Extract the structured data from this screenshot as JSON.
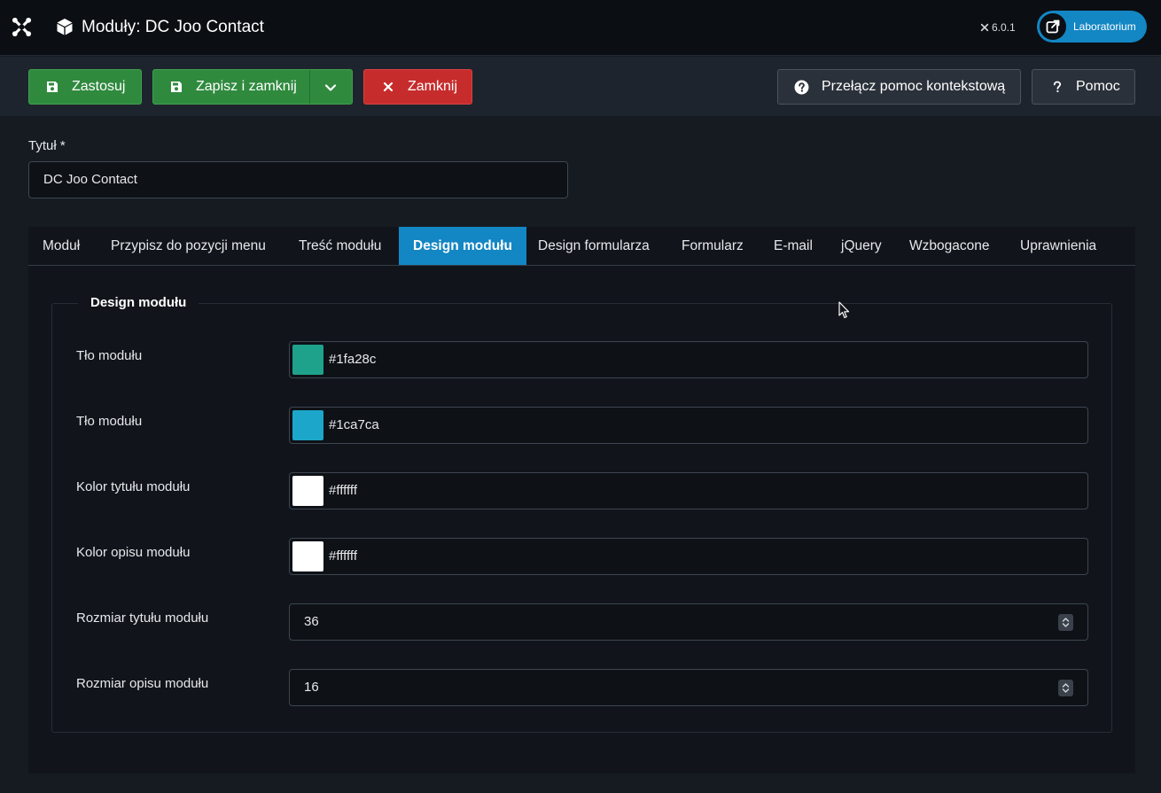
{
  "header": {
    "title": "Moduły: DC Joo Contact",
    "version": "6.0.1",
    "site_button_label": "Laboratorium",
    "logo_icon": "joomla-logo-icon",
    "title_icon": "cube-icon",
    "site_icon": "external-link-icon"
  },
  "toolbar": {
    "apply_label": "Zastosuj",
    "save_close_label": "Zapisz i zamknij",
    "close_label": "Zamknij",
    "context_help_label": "Przełącz pomoc kontekstową",
    "help_label": "Pomoc"
  },
  "form": {
    "title_label": "Tytuł *",
    "title_value": "DC Joo Contact"
  },
  "tabs": [
    "Moduł",
    "Przypisz do pozycji menu",
    "Treść modułu",
    "Design modułu",
    "Design formularza",
    "Formularz",
    "E-mail",
    "jQuery",
    "Wzbogacone",
    "Uprawnienia"
  ],
  "active_tab": "Design modułu",
  "design": {
    "legend": "Design modułu",
    "fields": [
      {
        "label": "Tło modułu",
        "type": "color",
        "value": "#1fa28c"
      },
      {
        "label": "Tło modułu",
        "type": "color",
        "value": "#1ca7ca"
      },
      {
        "label": "Kolor tytułu modułu",
        "type": "color",
        "value": "#ffffff"
      },
      {
        "label": "Kolor opisu modułu",
        "type": "color",
        "value": "#ffffff"
      },
      {
        "label": "Rozmiar tytułu modułu",
        "type": "number",
        "value": "36"
      },
      {
        "label": "Rozmiar opisu modułu",
        "type": "number",
        "value": "16"
      }
    ]
  },
  "colors": {
    "accent": "#1386c4",
    "success": "#2f8a3e",
    "danger": "#c72c2c",
    "swatch_1": "#1fa28c",
    "swatch_2": "#1ca7ca",
    "swatch_3": "#ffffff",
    "swatch_4": "#ffffff"
  }
}
